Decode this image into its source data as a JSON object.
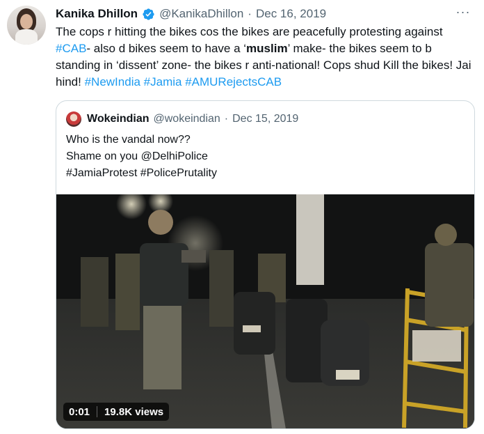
{
  "tweet": {
    "author_name": "Kanika Dhillon",
    "handle": "@KanikaDhillon",
    "separator": "·",
    "date": "Dec 16, 2019",
    "more": "···",
    "text_parts": [
      {
        "t": "The cops r hitting the bikes cos the bikes are peacefully protesting against ",
        "kind": "plain"
      },
      {
        "t": "#CAB",
        "kind": "link"
      },
      {
        "t": "- also d bikes seem to have a ‘",
        "kind": "plain"
      },
      {
        "t": "muslim",
        "kind": "bold"
      },
      {
        "t": "’ make- the bikes seem to b standing in ‘dissent’ zone- the bikes r anti-national! Cops shud Kill the bikes! Jai hind! ",
        "kind": "plain"
      },
      {
        "t": "#NewIndia",
        "kind": "link"
      },
      {
        "t": " ",
        "kind": "plain"
      },
      {
        "t": "#Jamia",
        "kind": "link"
      },
      {
        "t": " ",
        "kind": "plain"
      },
      {
        "t": "#AMURejectsCAB",
        "kind": "link"
      }
    ]
  },
  "quote": {
    "author_name": "Wokeindian",
    "handle": "@wokeindian",
    "separator": "·",
    "date": "Dec 15, 2019",
    "lines": [
      "Who is the vandal now??",
      "Shame on you @DelhiPolice",
      "#JamiaProtest #PolicePrutality"
    ]
  },
  "video": {
    "time": "0:01",
    "views": "19.8K views"
  },
  "colors": {
    "link": "#1d9bf0",
    "verified": "#1d9bf0",
    "secondary_text": "#536471"
  }
}
